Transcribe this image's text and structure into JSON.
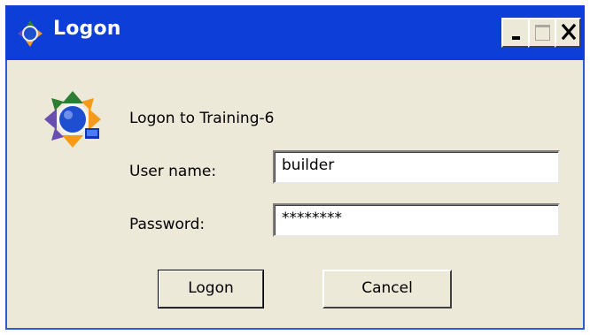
{
  "window": {
    "title": "Logon",
    "title_icon": "app-logo-icon",
    "titlebar_color": "#0d3fd8",
    "controls": {
      "minimize_icon": "minimize-icon",
      "maximize_icon": "maximize-icon",
      "close_icon": "close-icon"
    }
  },
  "dialog": {
    "icon": "app-logo-icon",
    "heading": "Logon to Training-6",
    "username_label": "User name:",
    "username_value": "builder",
    "password_label": "Password:",
    "password_value": "********",
    "logon_button": "Logon",
    "cancel_button": "Cancel"
  }
}
